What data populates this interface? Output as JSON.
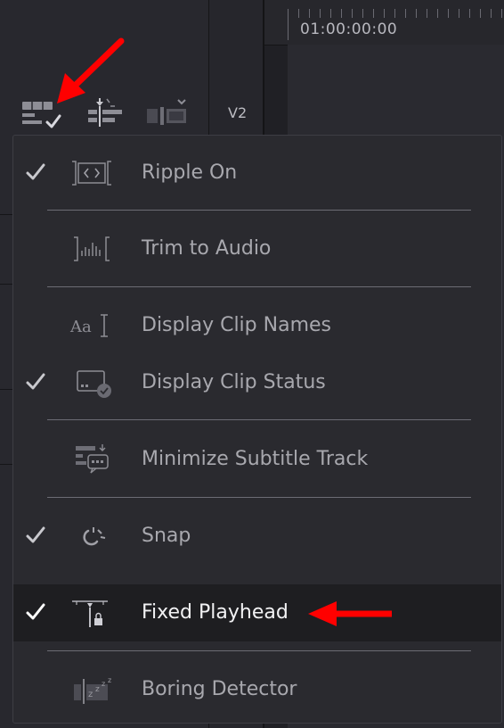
{
  "ruler": {
    "timecode": "01:00:00:00"
  },
  "toolbar": {
    "track_label": "V2",
    "icons": [
      "timeline-view-options-icon",
      "audio-track-options-icon",
      "video-track-options-icon"
    ]
  },
  "menu": {
    "items": [
      {
        "label": "Ripple On",
        "checked": true,
        "icon": "ripple-icon"
      },
      {
        "label": "Trim to Audio",
        "checked": false,
        "icon": "trim-to-audio-icon"
      },
      {
        "label": "Display Clip Names",
        "checked": false,
        "icon": "clip-names-icon"
      },
      {
        "label": "Display Clip Status",
        "checked": true,
        "icon": "clip-status-icon"
      },
      {
        "label": "Minimize Subtitle Track",
        "checked": false,
        "icon": "subtitle-track-icon"
      },
      {
        "label": "Snap",
        "checked": true,
        "icon": "snap-icon"
      },
      {
        "label": "Fixed Playhead",
        "checked": true,
        "highlighted": true,
        "icon": "fixed-playhead-icon"
      },
      {
        "label": "Boring Detector",
        "checked": false,
        "icon": "boring-detector-icon"
      }
    ]
  },
  "colors": {
    "background": "#1f1f23",
    "menu_background": "#2a2a2f",
    "highlight_background": "#1e1e21",
    "label_text": "#a8a8ae",
    "highlight_text": "#f2f2f4",
    "annotation_arrow": "#ff0000"
  }
}
